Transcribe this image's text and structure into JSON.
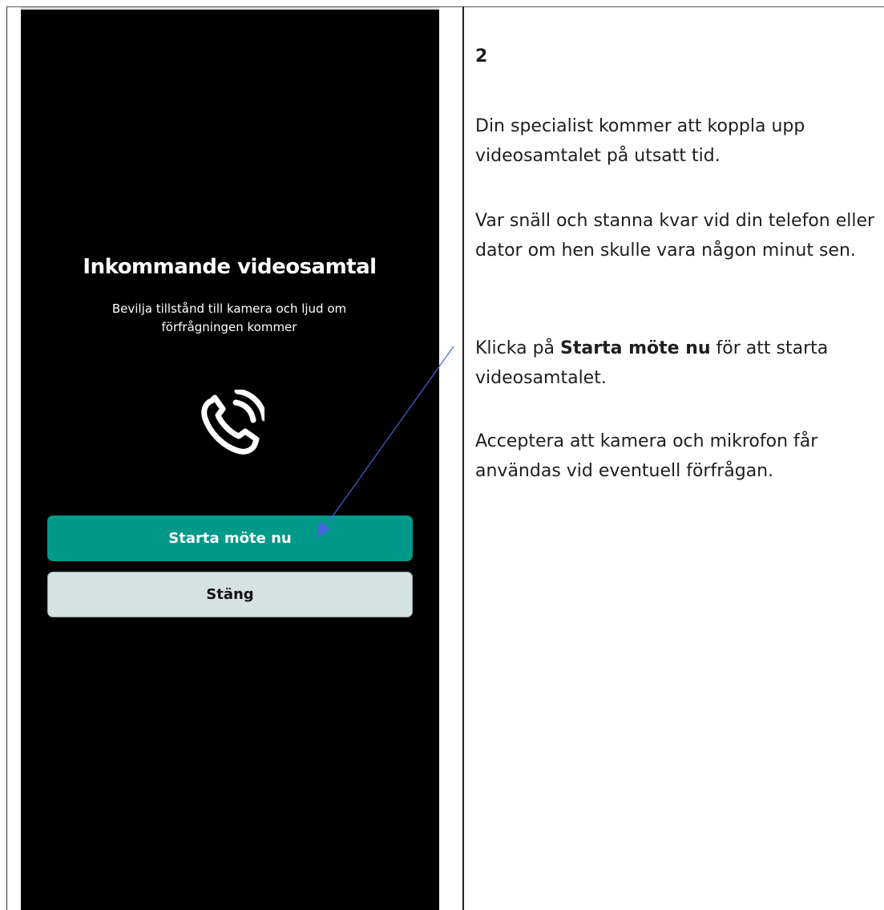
{
  "phone": {
    "title": "Inkommande videosamtal",
    "subtitle": "Bevilja tillstånd till kamera och ljud om förfrågningen kommer",
    "icon": "phone-call-icon",
    "start_button": "Starta möte nu",
    "close_button": "Stäng",
    "colors": {
      "background": "#000000",
      "start_button": "#00998a",
      "close_button": "#d5e2e2",
      "arrow": "#4466dd"
    }
  },
  "instructions": {
    "step_number": "2",
    "paragraph1": "Din specialist kommer att koppla upp videosamtalet på utsatt tid.",
    "paragraph2": "Var snäll och stanna kvar vid din telefon eller dator om hen skulle vara någon minut sen.",
    "paragraph3_prefix": "Klicka på ",
    "paragraph3_bold": "Starta möte nu",
    "paragraph3_suffix": " för att starta videosamtalet.",
    "paragraph4": "Acceptera att kamera och mikrofon får användas vid eventuell förfrågan."
  }
}
